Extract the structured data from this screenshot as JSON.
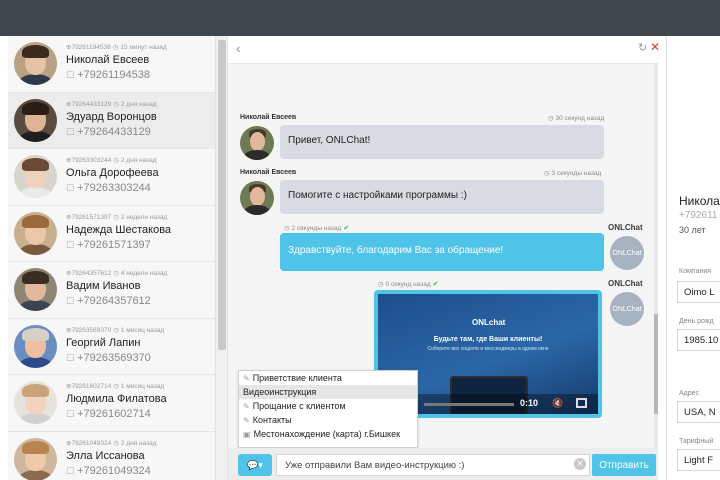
{
  "contacts": [
    {
      "id": "79261194538",
      "meta_time": "15 минут назад",
      "name": "Николай Евсеев",
      "phone": "+79261194538",
      "skin": "#e7c2a4",
      "hair": "#3a2a20",
      "shirt": "#2f3a4a",
      "bg": "#b9a184"
    },
    {
      "id": "79264433129",
      "meta_time": "2 дня назад",
      "name": "Эдуард Воронцов",
      "phone": "+79264433129",
      "skin": "#e0b394",
      "hair": "#2a1e16",
      "shirt": "#1f1f1f",
      "bg": "#5a4b3f"
    },
    {
      "id": "79263303244",
      "meta_time": "2 дня назад",
      "name": "Ольга Дорофеева",
      "phone": "+79263303244",
      "skin": "#f0d2bc",
      "hair": "#6b4a33",
      "shirt": "#e9e9e9",
      "bg": "#d9d4cc"
    },
    {
      "id": "79261571397",
      "meta_time": "2 недели назад",
      "name": "Надежда Шестакова",
      "phone": "+79261571397",
      "skin": "#ecc6a8",
      "hair": "#9a6a3e",
      "shirt": "#7a5940",
      "bg": "#c8b08f"
    },
    {
      "id": "79264357612",
      "meta_time": "4 недели назад",
      "name": "Вадим Иванов",
      "phone": "+79264357612",
      "skin": "#e3b89a",
      "hair": "#3c2d22",
      "shirt": "#3b4452",
      "bg": "#8e8474"
    },
    {
      "id": "79263569370",
      "meta_time": "1 месяц назад",
      "name": "Георгий Лапин",
      "phone": "+79263569370",
      "skin": "#eec0a0",
      "hair": "#d7d0c8",
      "shirt": "#2d4a8a",
      "bg": "#6a8ec2"
    },
    {
      "id": "79261602714",
      "meta_time": "1 месяц назад",
      "name": "Людмила Филатова",
      "phone": "+79261602714",
      "skin": "#f2d3bd",
      "hair": "#caa37a",
      "shirt": "#d0d0d0",
      "bg": "#e6e2dc"
    },
    {
      "id": "79261049324",
      "meta_time": "2 дня назад",
      "name": "Элла Иссанова",
      "phone": "+79261049324",
      "skin": "#f0c9ab",
      "hair": "#b9844f",
      "shirt": "#8c6a52",
      "bg": "#cdb89f"
    }
  ],
  "chat": {
    "messages": [
      {
        "sender": "Николай Евсеев",
        "time": "30 секунд назад",
        "text": "Привет, ONLChat!"
      },
      {
        "sender": "Николай Евсеев",
        "time": "3 секунды назад",
        "text": "Помогите с настройками программы :)"
      }
    ],
    "reply": {
      "time": "2 секунды назад",
      "text": "Здравствуйте, благодарим Вас за обращение!",
      "operator": "ONLChat",
      "operator_short": "ONLChat"
    },
    "video": {
      "time": "0 секунд назад",
      "operator": "ONLChat",
      "operator_short": "ONLChat",
      "logo": "ONLchat",
      "title": "Будьте там, где Ваши клиенты!",
      "subtitle": "Соберите все соцсети и мессенджеры в одном окне",
      "timestamp": "0:10"
    },
    "templates": [
      "Приветствие клиента",
      "Видеоинструкция",
      "Прощание с клиентом",
      "Контакты",
      "Местонахождение (карта) г.Бишкек"
    ],
    "input_value": "Уже отправили Вам видео-инструкцию :)",
    "send_label": "Отправить",
    "template_button": "▾"
  },
  "profile": {
    "name": "Никола",
    "phone": "+792611",
    "age": "30 лет",
    "fields": [
      {
        "label": "Компания",
        "value": "Oimo L"
      },
      {
        "label": "День рожд",
        "value": "1985.10"
      },
      {
        "label": "Адрес",
        "value": "USA, N"
      },
      {
        "label": "Тарифный",
        "value": "Light F"
      }
    ]
  },
  "colors": {
    "topbar": "#41454c",
    "accent": "#4fc3e8",
    "incoming_bubble": "#d8dbe1",
    "close": "#e23a2f"
  }
}
